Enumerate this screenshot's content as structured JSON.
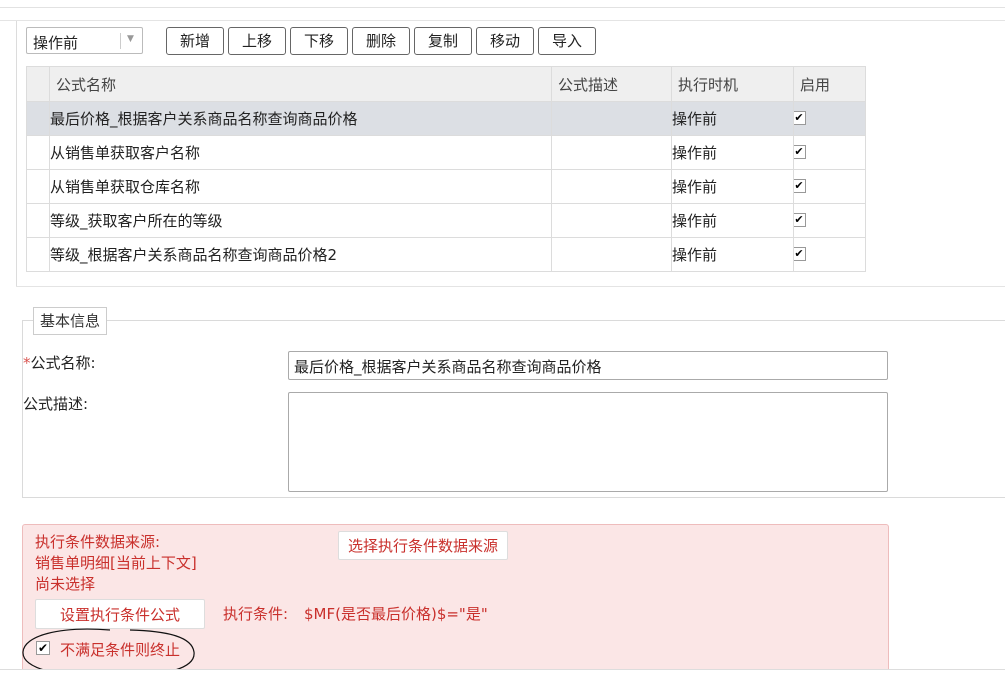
{
  "toolbar": {
    "timing_select": "操作前",
    "buttons": {
      "add": "新增",
      "move_up": "上移",
      "move_down": "下移",
      "delete": "删除",
      "copy": "复制",
      "move": "移动",
      "import": "导入"
    }
  },
  "table": {
    "headers": [
      "公式名称",
      "公式描述",
      "执行时机",
      "启用"
    ],
    "rows": [
      {
        "name": "最后价格_根据客户关系商品名称查询商品价格",
        "desc": "",
        "timing": "操作前",
        "enabled": true
      },
      {
        "name": "从销售单获取客户名称",
        "desc": "",
        "timing": "操作前",
        "enabled": true
      },
      {
        "name": "从销售单获取仓库名称",
        "desc": "",
        "timing": "操作前",
        "enabled": true
      },
      {
        "name": "等级_获取客户所在的等级",
        "desc": "",
        "timing": "操作前",
        "enabled": true
      },
      {
        "name": "等级_根据客户关系商品名称查询商品价格2",
        "desc": "",
        "timing": "操作前",
        "enabled": true
      }
    ],
    "selected_row": 0
  },
  "basic_info": {
    "legend": "基本信息",
    "required_mark": "*",
    "name_label": "公式名称:",
    "name_value": "最后价格_根据客户关系商品名称查询商品价格",
    "desc_label": "公式描述:",
    "desc_value": ""
  },
  "condition": {
    "source_label": "执行条件数据来源:",
    "source_value": "销售单明细[当前上下文]",
    "source_status": "尚未选择",
    "select_source_button": "选择执行条件数据来源",
    "set_formula_button": "设置执行条件公式",
    "condition_label": "执行条件:",
    "condition_value": "$MF(是否最后价格)$=\"是\"",
    "terminate_label": "不满足条件则终止",
    "terminate_checked": true
  },
  "colors": {
    "selected_row": "#dcdfe4",
    "alert_bg": "#fbe6e6",
    "alert_text": "#c9302c"
  }
}
